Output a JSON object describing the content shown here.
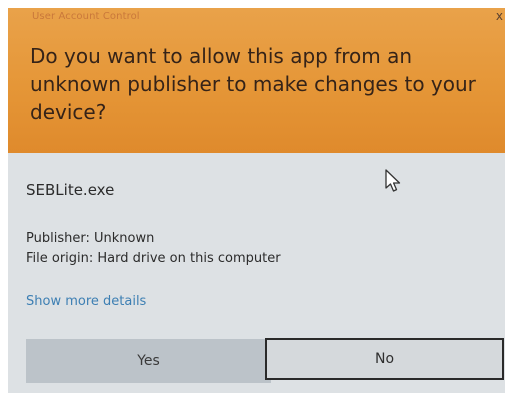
{
  "dialog": {
    "title": "User Account Control",
    "close_glyph": "x",
    "question": "Do you want to allow this app from an unknown publisher to make changes to your device?",
    "app_name": "SEBLite.exe",
    "publisher_line": "Publisher: Unknown",
    "origin_line": "File origin: Hard drive on this computer",
    "more_details_label": "Show more details",
    "yes_label": "Yes",
    "no_label": "No"
  },
  "icons": {
    "cursor": "mouse-pointer-icon",
    "close": "close-icon"
  },
  "colors": {
    "header": "#e59637",
    "body": "#dde1e4",
    "link": "#3d7fb3",
    "yes_button": "#bcc3c9",
    "question_text": "#352318"
  }
}
